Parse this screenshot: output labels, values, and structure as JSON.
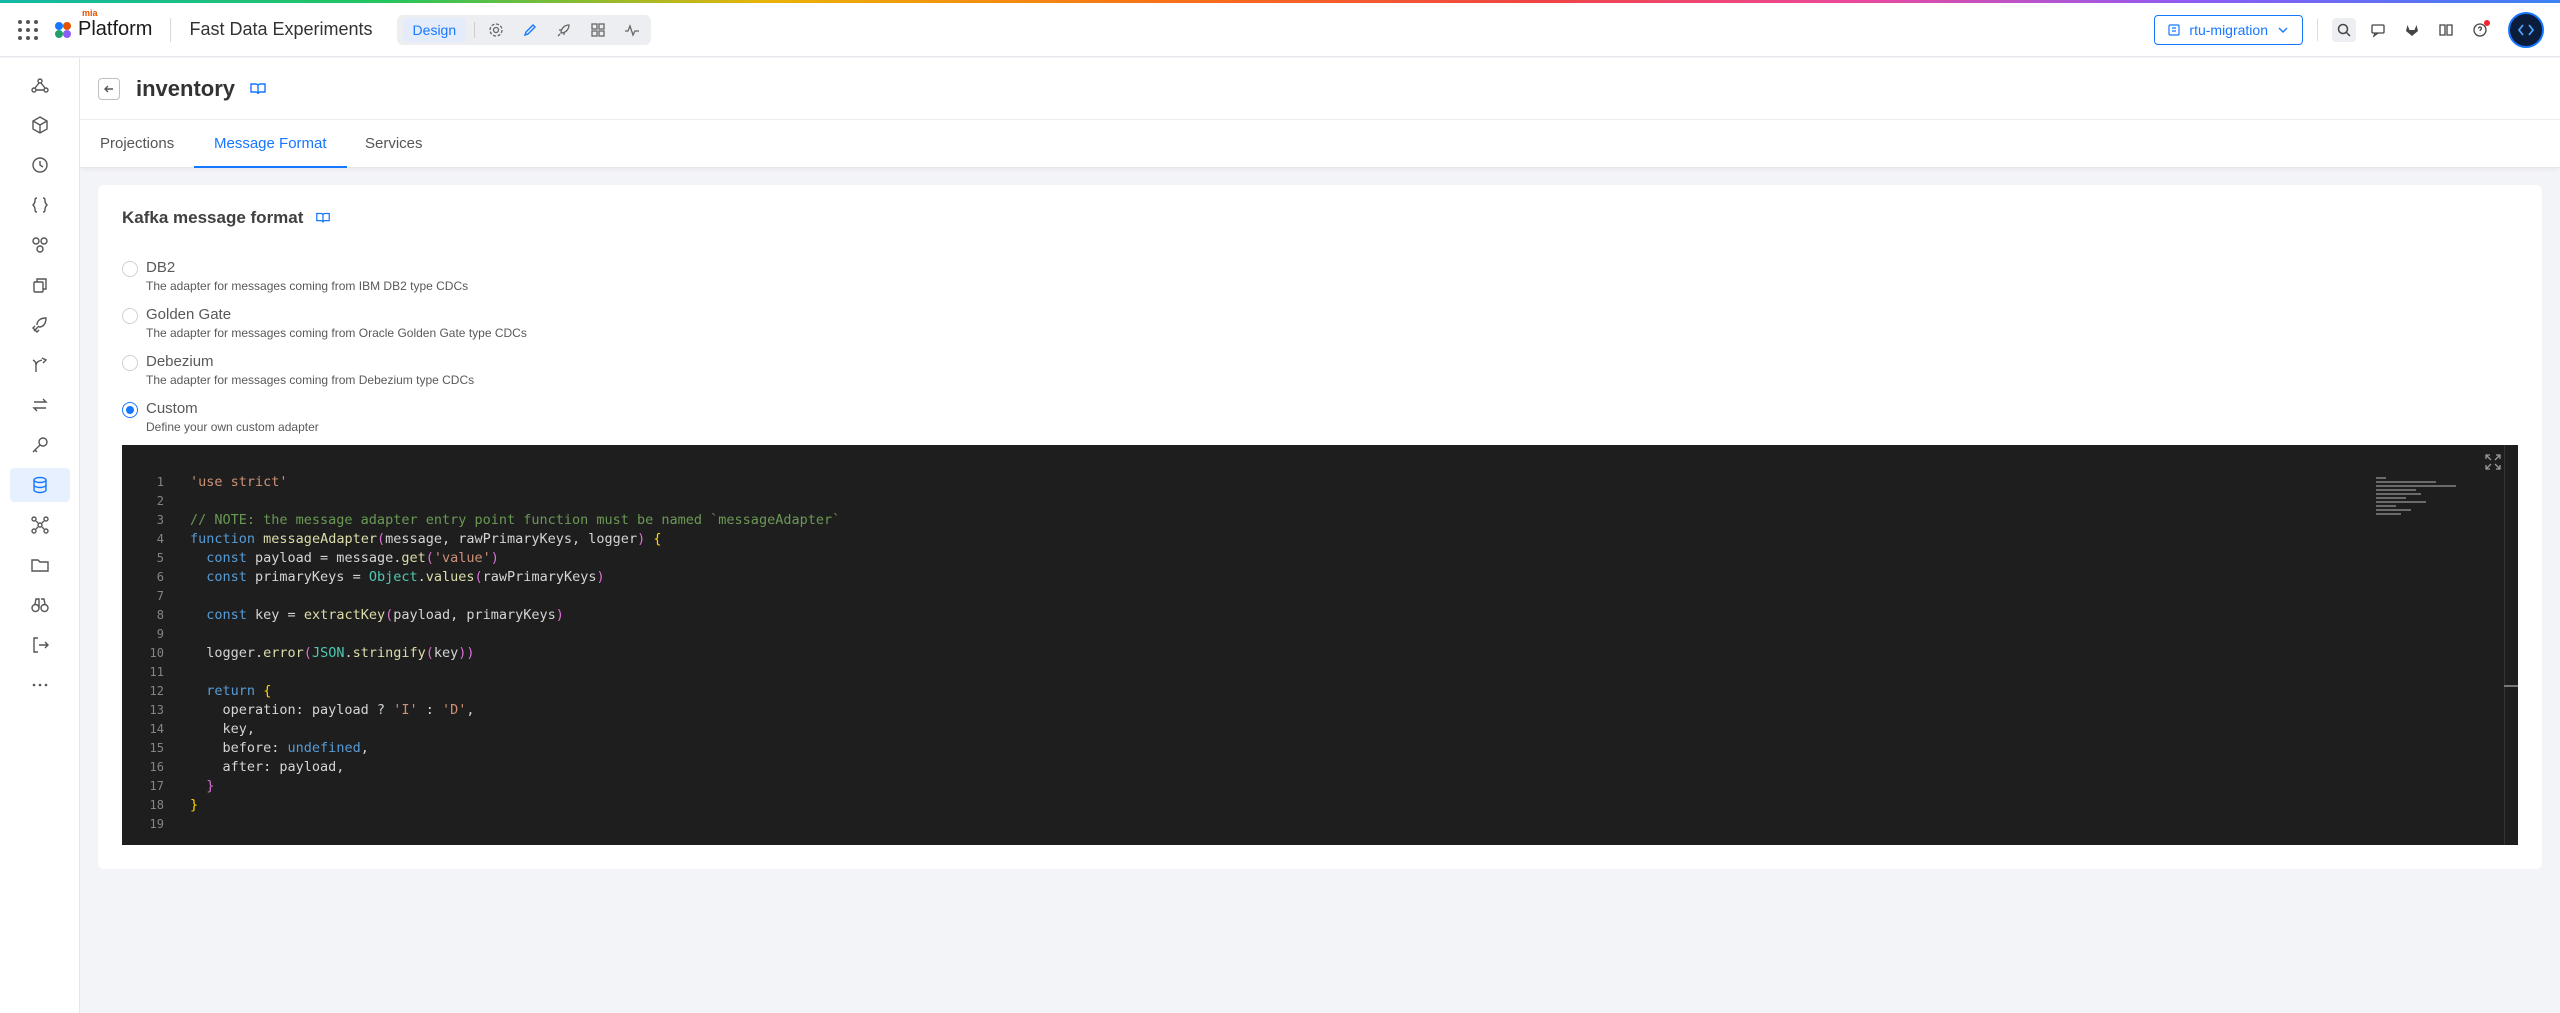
{
  "topbar": {
    "logo_small": "mia",
    "logo_text": "Platform",
    "project_name": "Fast Data Experiments",
    "mode_label": "Design",
    "branch_label": "rtu-migration"
  },
  "page": {
    "title": "inventory"
  },
  "tabs": [
    {
      "label": "Projections"
    },
    {
      "label": "Message Format"
    },
    {
      "label": "Services"
    }
  ],
  "card": {
    "title": "Kafka message format",
    "options": [
      {
        "title": "DB2",
        "desc": "The adapter for messages coming from IBM DB2 type CDCs",
        "selected": false
      },
      {
        "title": "Golden Gate",
        "desc": "The adapter for messages coming from Oracle Golden Gate type CDCs",
        "selected": false
      },
      {
        "title": "Debezium",
        "desc": "The adapter for messages coming from Debezium type CDCs",
        "selected": false
      },
      {
        "title": "Custom",
        "desc": "Define your own custom adapter",
        "selected": true
      }
    ]
  },
  "editor": {
    "line_numbers": [
      "1",
      "2",
      "3",
      "4",
      "5",
      "6",
      "7",
      "8",
      "9",
      "10",
      "11",
      "12",
      "13",
      "14",
      "15",
      "16",
      "17",
      "18",
      "19"
    ],
    "code_lines": [
      "'use strict'",
      "",
      "// NOTE: the message adapter entry point function must be named `messageAdapter`",
      "function messageAdapter(message, rawPrimaryKeys, logger) {",
      "  const payload = message.get('value')",
      "  const primaryKeys = Object.values(rawPrimaryKeys)",
      "",
      "  const key = extractKey(payload, primaryKeys)",
      "",
      "  logger.error(JSON.stringify(key))",
      "",
      "  return {",
      "    operation: payload ? 'I' : 'D',",
      "    key,",
      "    before: undefined,",
      "    after: payload,",
      "  }",
      "}",
      ""
    ]
  },
  "colors": {
    "accent": "#1677ff",
    "editor_bg": "#1e1e1e"
  },
  "icons": {
    "sidebar": [
      "graph-icon",
      "cube-icon",
      "history-icon",
      "braces-icon",
      "nodes-icon",
      "copy-icon",
      "deploy-icon",
      "branch-icon",
      "swap-icon",
      "key-icon",
      "database-icon",
      "network-icon",
      "folder-icon",
      "binoculars-icon",
      "logout-icon",
      "more-icon"
    ]
  }
}
